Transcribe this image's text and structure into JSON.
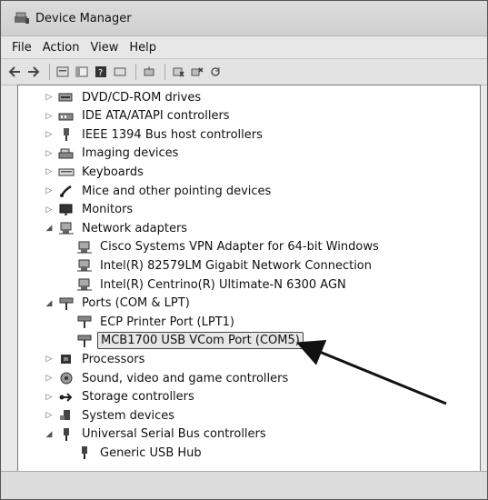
{
  "window": {
    "title": "Device Manager"
  },
  "menu": [
    "File",
    "Action",
    "View",
    "Help"
  ],
  "toolbar_icons": [
    "back-arrow-icon",
    "forward-arrow-icon",
    "properties-icon",
    "grid-icon",
    "help-icon",
    "view-icon",
    "update-driver-icon",
    "uninstall-icon",
    "scan-hardware-icon"
  ],
  "tree": [
    {
      "label": "DVD/CD-ROM drives",
      "expanded": false,
      "level": 0,
      "icon": "dvd-drive-icon"
    },
    {
      "label": "IDE ATA/ATAPI controllers",
      "expanded": false,
      "level": 0,
      "icon": "ide-controller-icon"
    },
    {
      "label": "IEEE 1394 Bus host controllers",
      "expanded": false,
      "level": 0,
      "icon": "firewire-icon"
    },
    {
      "label": "Imaging devices",
      "expanded": false,
      "level": 0,
      "icon": "scanner-icon"
    },
    {
      "label": "Keyboards",
      "expanded": false,
      "level": 0,
      "icon": "keyboard-icon"
    },
    {
      "label": "Mice and other pointing devices",
      "expanded": false,
      "level": 0,
      "icon": "mouse-icon"
    },
    {
      "label": "Monitors",
      "expanded": false,
      "level": 0,
      "icon": "monitor-icon"
    },
    {
      "label": "Network adapters",
      "expanded": true,
      "level": 0,
      "icon": "network-adapter-icon"
    },
    {
      "label": "Cisco Systems VPN Adapter for 64-bit Windows",
      "level": 1,
      "icon": "network-adapter-icon"
    },
    {
      "label": "Intel(R) 82579LM Gigabit Network Connection",
      "level": 1,
      "icon": "network-adapter-icon"
    },
    {
      "label": "Intel(R) Centrino(R) Ultimate-N 6300 AGN",
      "level": 1,
      "icon": "network-adapter-icon"
    },
    {
      "label": "Ports (COM & LPT)",
      "expanded": true,
      "level": 0,
      "icon": "port-icon"
    },
    {
      "label": "ECP Printer Port (LPT1)",
      "level": 1,
      "icon": "port-icon"
    },
    {
      "label": "MCB1700 USB VCom Port (COM5)",
      "level": 1,
      "icon": "port-icon",
      "selected": true
    },
    {
      "label": "Processors",
      "expanded": false,
      "level": 0,
      "icon": "processor-icon"
    },
    {
      "label": "Sound, video and game controllers",
      "expanded": false,
      "level": 0,
      "icon": "sound-icon"
    },
    {
      "label": "Storage controllers",
      "expanded": false,
      "level": 0,
      "icon": "storage-icon"
    },
    {
      "label": "System devices",
      "expanded": false,
      "level": 0,
      "icon": "system-devices-icon"
    },
    {
      "label": "Universal Serial Bus controllers",
      "expanded": true,
      "level": 0,
      "icon": "usb-icon"
    },
    {
      "label": "Generic USB Hub",
      "level": 1,
      "icon": "usb-icon"
    }
  ]
}
